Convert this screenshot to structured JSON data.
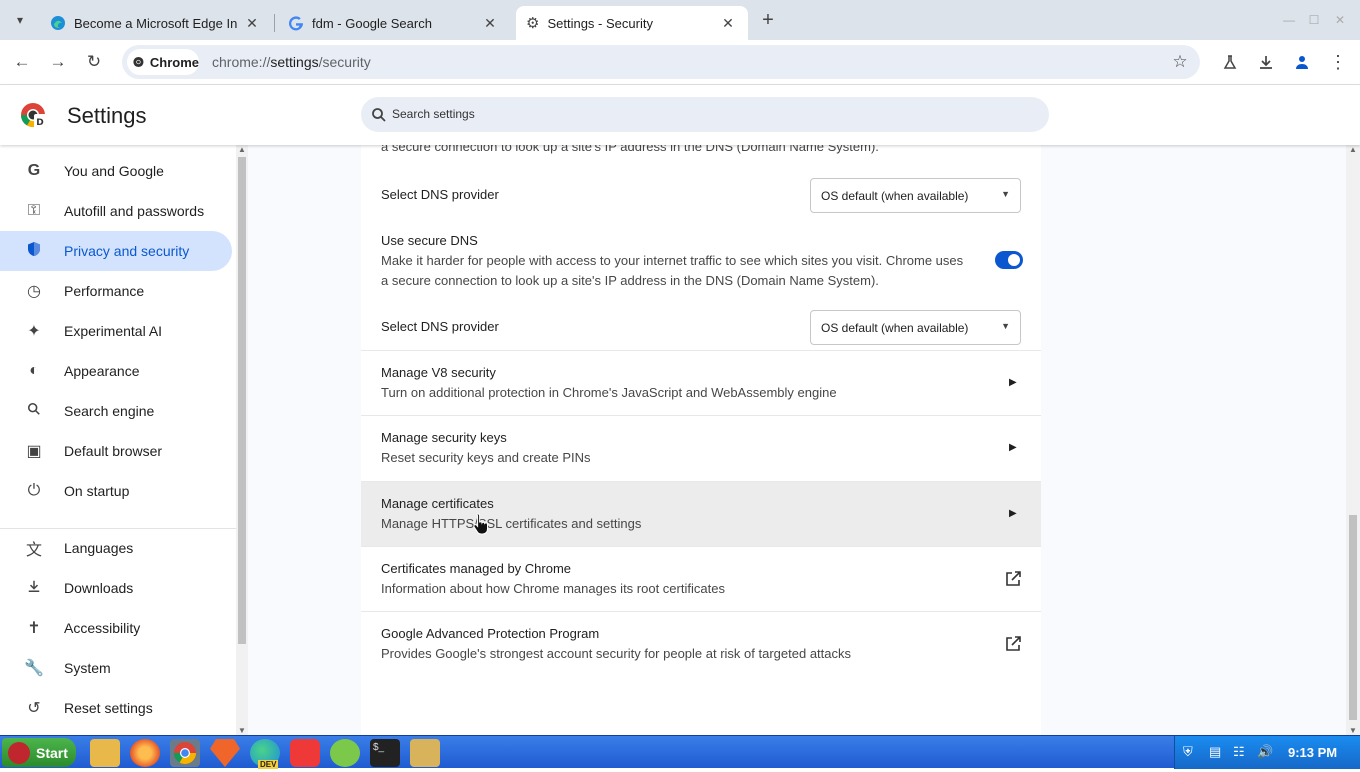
{
  "tabs": [
    {
      "title": "Become a Microsoft Edge In",
      "icon": "edge-icon"
    },
    {
      "title": "fdm - Google Search",
      "icon": "google-icon"
    },
    {
      "title": "Settings - Security",
      "icon": "gear-icon"
    }
  ],
  "toolbar": {
    "site_chip": "Chrome",
    "url_prefix": "chrome://",
    "url_host": "settings",
    "url_path": "/security"
  },
  "settings_header": {
    "title": "Settings",
    "search_placeholder": "Search settings"
  },
  "sidebar": {
    "items": [
      {
        "label": "You and Google",
        "icon": "google-g-icon"
      },
      {
        "label": "Autofill and passwords",
        "icon": "key-icon"
      },
      {
        "label": "Privacy and security",
        "icon": "shield-icon",
        "selected": true
      },
      {
        "label": "Performance",
        "icon": "speedometer-icon"
      },
      {
        "label": "Experimental AI",
        "icon": "sparkle-icon"
      },
      {
        "label": "Appearance",
        "icon": "palette-icon"
      },
      {
        "label": "Search engine",
        "icon": "search-icon"
      },
      {
        "label": "Default browser",
        "icon": "browser-window-icon"
      },
      {
        "label": "On startup",
        "icon": "power-icon"
      },
      {
        "label": "Languages",
        "icon": "translate-icon"
      },
      {
        "label": "Downloads",
        "icon": "download-icon"
      },
      {
        "label": "Accessibility",
        "icon": "accessibility-icon"
      },
      {
        "label": "System",
        "icon": "wrench-icon"
      },
      {
        "label": "Reset settings",
        "icon": "reset-icon"
      }
    ]
  },
  "content": {
    "top_clipped_desc": "a secure connection to look up a site's IP address in the DNS (Domain Name System).",
    "dns_provider_1": {
      "label": "Select DNS provider",
      "value": "OS default (when available)"
    },
    "secure_dns": {
      "title": "Use secure DNS",
      "desc_line1": "Make it harder for people with access to your internet traffic to see which sites you visit. Chrome uses",
      "desc_line2": "a secure connection to look up a site's IP address in the DNS (Domain Name System).",
      "enabled": true
    },
    "dns_provider_2": {
      "label": "Select DNS provider",
      "value": "OS default (when available)"
    },
    "rows": [
      {
        "title": "Manage V8 security",
        "desc": "Turn on additional protection in Chrome's JavaScript and WebAssembly engine",
        "action": "arrow"
      },
      {
        "title": "Manage security keys",
        "desc": "Reset security keys and create PINs",
        "action": "arrow"
      },
      {
        "title": "Manage certificates",
        "desc": "Manage HTTPS/SSL certificates and settings",
        "action": "arrow",
        "hovered": true
      },
      {
        "title": "Certificates managed by Chrome",
        "desc": "Information about how Chrome manages its root certificates",
        "action": "external"
      },
      {
        "title": "Google Advanced Protection Program",
        "desc": "Provides Google's strongest account security for people at risk of targeted attacks",
        "action": "external"
      }
    ]
  },
  "taskbar": {
    "start_label": "Start",
    "clock": "9:13 PM",
    "dev_badge": "DEV"
  },
  "colors": {
    "accent": "#0b57d0",
    "selected_nav_bg": "#d3e3fd",
    "taskbar_blue": "#2a6ae0",
    "start_green": "#3ca03c"
  }
}
